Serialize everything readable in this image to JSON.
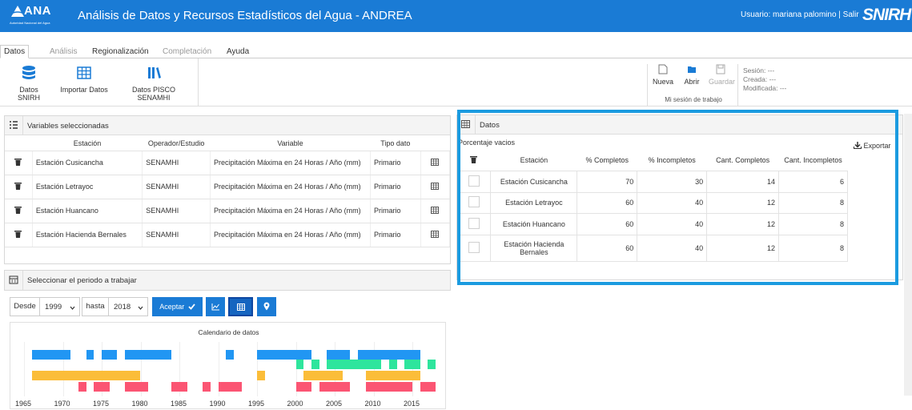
{
  "header": {
    "logo_text": "ANA",
    "logo_subtext": "Autoridad Nacional del Agua",
    "title": "Análisis de Datos y Recursos Estadísticos del Agua - ANDREA",
    "user": "Usuario: mariana palomino | Salir",
    "brand": "SNIRH",
    "bg_color": "#1a7bd5"
  },
  "menu": {
    "items": [
      {
        "label": "Datos",
        "state": "active"
      },
      {
        "label": "Análisis",
        "state": "disabled"
      },
      {
        "label": "Regionalización",
        "state": "enabled"
      },
      {
        "label": "Completación",
        "state": "disabled"
      },
      {
        "label": "Ayuda",
        "state": "enabled"
      }
    ]
  },
  "toolbar": {
    "snirh": "Datos SNIRH",
    "import": "Importar Datos",
    "pisco": "Datos PISCO SENAMHI"
  },
  "session": {
    "nueva": "Nueva",
    "abrir": "Abrir",
    "guardar": "Guardar",
    "caption": "Mi sesión de trabajo",
    "sesion": "Sesión: ---",
    "creada": "Creada: ---",
    "modificada": "Modificada: ---"
  },
  "variables": {
    "title": "Variables seleccionadas",
    "columns": [
      "Estación",
      "Operador/Estudio",
      "Variable",
      "Tipo dato"
    ],
    "rows": [
      {
        "estacion": "Estación Cusicancha",
        "operador": "SENAMHI",
        "variable": "Precipitación Máxima en 24 Horas / Año (mm)",
        "tipo": "Primario"
      },
      {
        "estacion": "Estación Letrayoc",
        "operador": "SENAMHI",
        "variable": "Precipitación Máxima en 24 Horas / Año (mm)",
        "tipo": "Primario"
      },
      {
        "estacion": "Estación Huancano",
        "operador": "SENAMHI",
        "variable": "Precipitación Máxima en 24 Horas / Año (mm)",
        "tipo": "Primario"
      },
      {
        "estacion": "Estación Hacienda Bernales",
        "operador": "SENAMHI",
        "variable": "Precipitación Máxima en 24 Horas / Año (mm)",
        "tipo": "Primario"
      }
    ]
  },
  "period": {
    "title": "Seleccionar el periodo a trabajar",
    "desde_label": "Desde",
    "desde_value": "1999",
    "hasta_label": "hasta",
    "hasta_value": "2018",
    "accept": "Aceptar"
  },
  "calendar": {
    "title": "Calendario de datos",
    "years": [
      "1965",
      "1970",
      "1975",
      "1980",
      "1985",
      "1990",
      "1995",
      "2000",
      "2005",
      "2010",
      "2015"
    ],
    "colors": {
      "blue": "#2196f3",
      "green": "#2ee59d",
      "orange": "#fbbd39",
      "red": "#fb5573"
    },
    "rows": [
      {
        "color": "blue",
        "ranges": [
          [
            1966,
            1971
          ],
          [
            1973,
            1974
          ],
          [
            1975,
            1977
          ],
          [
            1978,
            1984
          ],
          [
            1991,
            1992
          ],
          [
            1995,
            2002
          ],
          [
            2004,
            2007
          ],
          [
            2008,
            2016
          ]
        ]
      },
      {
        "color": "green",
        "ranges": [
          [
            2000,
            2001
          ],
          [
            2002,
            2003
          ],
          [
            2004,
            2011
          ],
          [
            2012,
            2013
          ],
          [
            2014,
            2016
          ],
          [
            2017,
            2018
          ]
        ]
      },
      {
        "color": "orange",
        "ranges": [
          [
            1966,
            1980
          ],
          [
            1995,
            1996
          ],
          [
            2001,
            2006
          ],
          [
            2009,
            2016
          ]
        ]
      },
      {
        "color": "red",
        "ranges": [
          [
            1972,
            1973
          ],
          [
            1974,
            1976
          ],
          [
            1978,
            1981
          ],
          [
            1984,
            1986
          ],
          [
            1988,
            1989
          ],
          [
            1990,
            1993
          ],
          [
            2000,
            2002
          ],
          [
            2003,
            2007
          ],
          [
            2009,
            2015
          ],
          [
            2016,
            2018
          ]
        ]
      }
    ]
  },
  "datos": {
    "title": "Datos",
    "subtitle": "Porcentaje vacios",
    "export": "Exportar",
    "columns": [
      "Estación",
      "% Completos",
      "% Incompletos",
      "Cant. Completos",
      "Cant. Incompletos"
    ],
    "rows": [
      {
        "estacion": "Estación Cusicancha",
        "pc": "70",
        "pi": "30",
        "cc": "14",
        "ci": "6"
      },
      {
        "estacion": "Estación Letrayoc",
        "pc": "60",
        "pi": "40",
        "cc": "12",
        "ci": "8"
      },
      {
        "estacion": "Estación Huancano",
        "pc": "60",
        "pi": "40",
        "cc": "12",
        "ci": "8"
      },
      {
        "estacion": "Estación Hacienda Bernales",
        "pc": "60",
        "pi": "40",
        "cc": "12",
        "ci": "8"
      }
    ]
  }
}
